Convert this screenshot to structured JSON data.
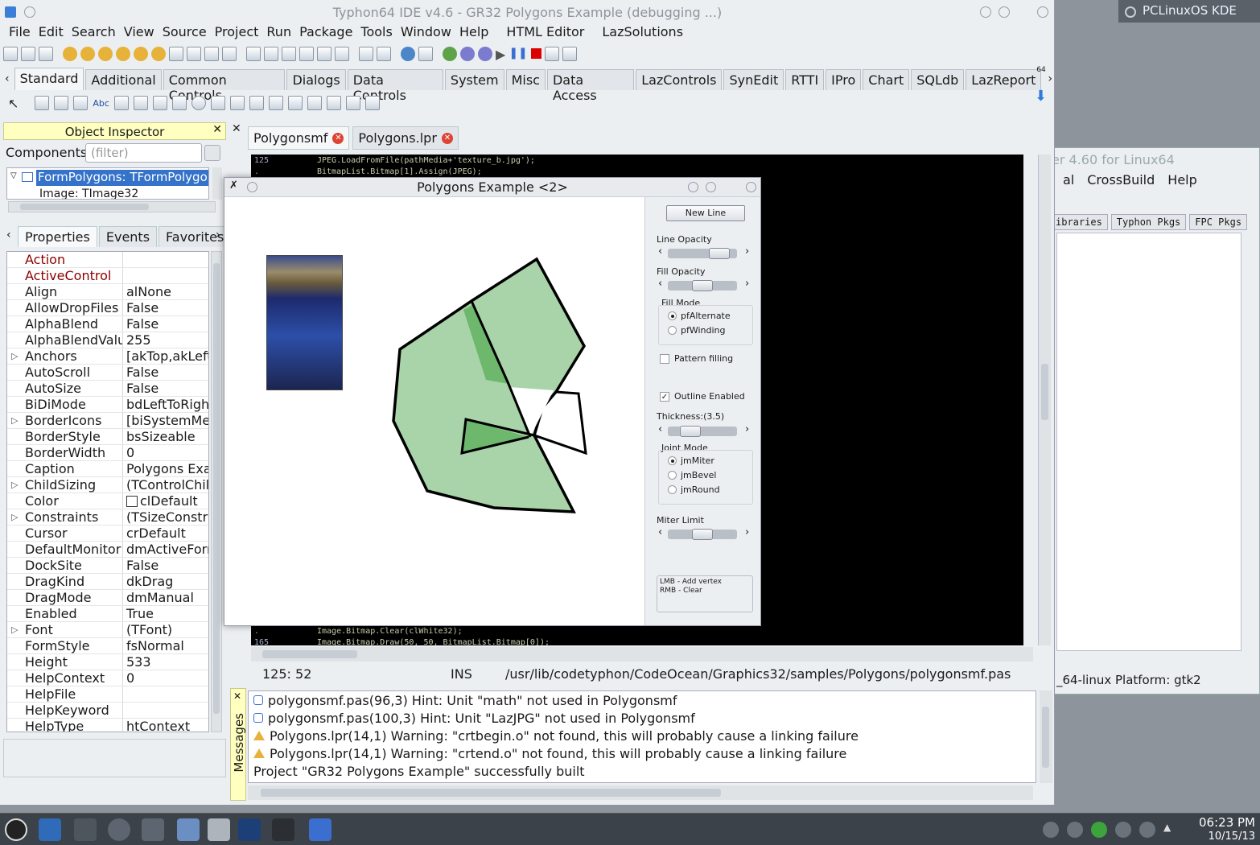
{
  "desktop": {
    "label": "PCLinuxOS KDE"
  },
  "bg_window": {
    "title": "er 4.60 for Linux64",
    "menu": [
      "al",
      "CrossBuild",
      "Help"
    ],
    "tabs": [
      "ibraries",
      "Typhon Pkgs",
      "FPC Pkgs"
    ],
    "status": "_64-linux Platform: gtk2"
  },
  "ide": {
    "title": "Typhon64 IDE v4.6 - GR32 Polygons Example (debugging ...)",
    "menu": [
      "File",
      "Edit",
      "Search",
      "View",
      "Source",
      "Project",
      "Run",
      "Package",
      "Tools",
      "Window",
      "Help",
      "HTML Editor",
      "LazSolutions"
    ],
    "palette_tabs": [
      "Standard",
      "Additional",
      "Common Controls",
      "Dialogs",
      "Data Controls",
      "System",
      "Misc",
      "Data Access",
      "LazControls",
      "SynEdit",
      "RTTI",
      "IPro",
      "Chart",
      "SQLdb",
      "LazReport"
    ],
    "palette_badge": "64"
  },
  "object_inspector": {
    "title": "Object Inspector",
    "components_label": "Components",
    "filter_placeholder": "(filter)",
    "tree_selected": "FormPolygons: TFormPolygo",
    "tree_child": "Image: TImage32",
    "tabs": [
      "Properties",
      "Events",
      "Favorites"
    ],
    "properties": [
      {
        "name": "Action",
        "value": "",
        "red": true
      },
      {
        "name": "ActiveControl",
        "value": "",
        "red": true
      },
      {
        "name": "Align",
        "value": "alNone"
      },
      {
        "name": "AllowDropFiles",
        "value": "False"
      },
      {
        "name": "AlphaBlend",
        "value": "False"
      },
      {
        "name": "AlphaBlendValue",
        "value": "255"
      },
      {
        "name": "Anchors",
        "value": "[akTop,akLeft",
        "expand": true
      },
      {
        "name": "AutoScroll",
        "value": "False"
      },
      {
        "name": "AutoSize",
        "value": "False"
      },
      {
        "name": "BiDiMode",
        "value": "bdLeftToRight"
      },
      {
        "name": "BorderIcons",
        "value": "[biSystemMen",
        "expand": true
      },
      {
        "name": "BorderStyle",
        "value": "bsSizeable"
      },
      {
        "name": "BorderWidth",
        "value": "0"
      },
      {
        "name": "Caption",
        "value": "Polygons Exar"
      },
      {
        "name": "ChildSizing",
        "value": "(TControlChil",
        "expand": true
      },
      {
        "name": "Color",
        "value": "clDefault"
      },
      {
        "name": "Constraints",
        "value": "(TSizeConstra",
        "expand": true
      },
      {
        "name": "Cursor",
        "value": "crDefault"
      },
      {
        "name": "DefaultMonitor",
        "value": "dmActiveForm"
      },
      {
        "name": "DockSite",
        "value": "False"
      },
      {
        "name": "DragKind",
        "value": "dkDrag"
      },
      {
        "name": "DragMode",
        "value": "dmManual"
      },
      {
        "name": "Enabled",
        "value": "True"
      },
      {
        "name": "Font",
        "value": "(TFont)",
        "expand": true
      },
      {
        "name": "FormStyle",
        "value": "fsNormal"
      },
      {
        "name": "Height",
        "value": "533"
      },
      {
        "name": "HelpContext",
        "value": "0"
      },
      {
        "name": "HelpFile",
        "value": ""
      },
      {
        "name": "HelpKeyword",
        "value": ""
      },
      {
        "name": "HelpType",
        "value": "htContext"
      }
    ]
  },
  "editor": {
    "tabs": [
      "Polygonsmf",
      "Polygons.lpr"
    ],
    "lines_top": [
      {
        "num": "125",
        "code": "JPEG.LoadFromFile(pathMedia+'texture_b.jpg');"
      },
      {
        "num": ".",
        "code": "BitmapList.Bitmap[1].Assign(JPEG);"
      }
    ],
    "lines_bottom": [
      {
        "num": ".",
        "code": "Image.Bitmap.Clear(clWhite32);"
      },
      {
        "num": "165",
        "code": "Image.Bitmap.Draw(50, 50, BitmapList.Bitmap[0]);"
      }
    ],
    "status": {
      "pos": "125:  52",
      "mode": "INS",
      "path": "/usr/lib/codetyphon/CodeOcean/Graphics32/samples/Polygons/polygonsmf.pas"
    }
  },
  "messages": {
    "title": "Messages",
    "items": [
      {
        "type": "hint",
        "text": "polygonsmf.pas(96,3) Hint: Unit \"math\" not used in Polygonsmf"
      },
      {
        "type": "hint",
        "text": "polygonsmf.pas(100,3) Hint: Unit \"LazJPG\" not used in Polygonsmf"
      },
      {
        "type": "warning",
        "text": "Polygons.lpr(14,1) Warning: \"crtbegin.o\" not found, this will probably cause a linking failure"
      },
      {
        "type": "warning",
        "text": "Polygons.lpr(14,1) Warning: \"crtend.o\" not found, this will probably cause a linking failure"
      },
      {
        "type": "info",
        "text": "Project \"GR32 Polygons Example\" successfully built"
      }
    ]
  },
  "example": {
    "title": "Polygons Example <2>",
    "new_line": "New Line",
    "line_opacity": "Line Opacity",
    "line_opacity_value": 0.85,
    "fill_opacity": "Fill Opacity",
    "fill_opacity_value": 0.5,
    "fill_mode": "Fill Mode",
    "fill_modes": [
      "pfAlternate",
      "pfWinding"
    ],
    "fill_mode_selected": 0,
    "pattern_filling": "Pattern filling",
    "pattern_checked": false,
    "outline_enabled": "Outline Enabled",
    "outline_checked": true,
    "thickness": "Thickness:(3.5)",
    "thickness_value": 0.25,
    "joint_mode": "Joint Mode",
    "joint_modes": [
      "jmMiter",
      "jmBevel",
      "jmRound"
    ],
    "joint_mode_selected": 0,
    "miter_limit": "Miter Limit",
    "miter_value": 0.5,
    "hint_lines": [
      "LMB - Add vertex",
      "RMB - Clear"
    ],
    "fill_color": "#a9d4a9",
    "overlap_color": "#6db86d"
  },
  "taskbar": {
    "time": "06:23 PM",
    "date": "10/15/13"
  }
}
